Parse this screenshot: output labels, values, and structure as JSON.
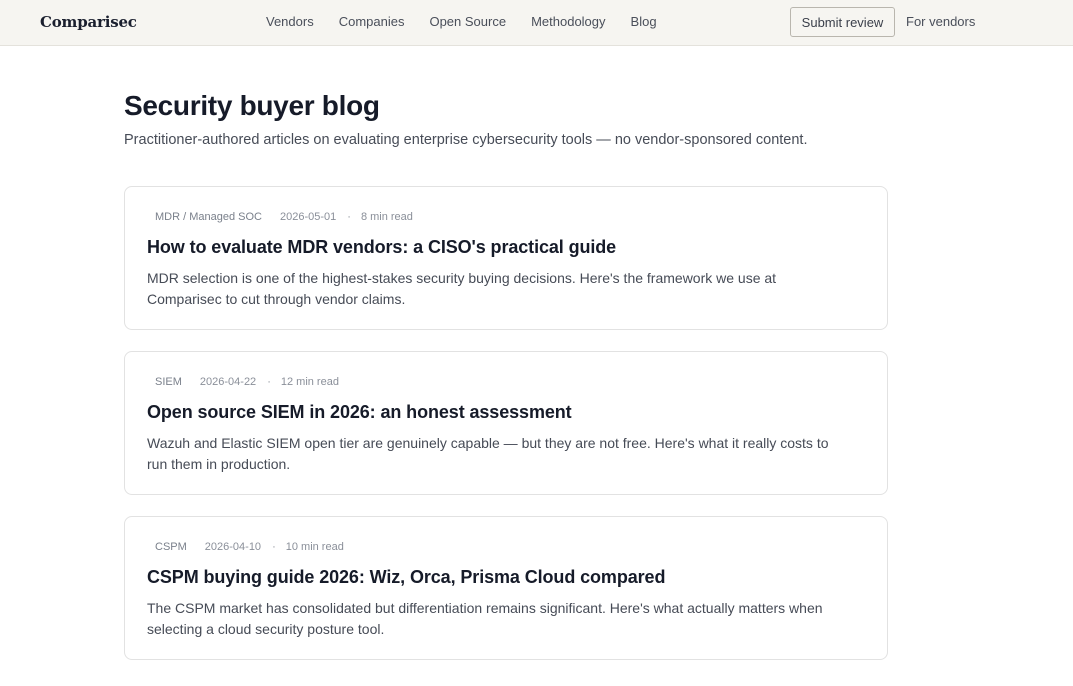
{
  "header": {
    "logo": "Comparisec",
    "nav": [
      "Vendors",
      "Companies",
      "Open Source",
      "Methodology",
      "Blog"
    ],
    "submit_label": "Submit review",
    "for_vendors_label": "For vendors"
  },
  "page": {
    "title": "Security buyer blog",
    "subtitle": "Practitioner-authored articles on evaluating enterprise cybersecurity tools — no vendor-sponsored content."
  },
  "posts": [
    {
      "category": "MDR / Managed SOC",
      "date": "2026-05-01",
      "separator": "·",
      "read_time": "8 min read",
      "title": "How to evaluate MDR vendors: a CISO's practical guide",
      "excerpt": "MDR selection is one of the highest-stakes security buying decisions. Here's the framework we use at Comparisec to cut through vendor claims."
    },
    {
      "category": "SIEM",
      "date": "2026-04-22",
      "separator": "·",
      "read_time": "12 min read",
      "title": "Open source SIEM in 2026: an honest assessment",
      "excerpt": "Wazuh and Elastic SIEM open tier are genuinely capable — but they are not free. Here's what it really costs to run them in production."
    },
    {
      "category": "CSPM",
      "date": "2026-04-10",
      "separator": "·",
      "read_time": "10 min read",
      "title": "CSPM buying guide 2026: Wiz, Orca, Prisma Cloud compared",
      "excerpt": "The CSPM market has consolidated but differentiation remains significant. Here's what actually matters when selecting a cloud security posture tool."
    }
  ]
}
